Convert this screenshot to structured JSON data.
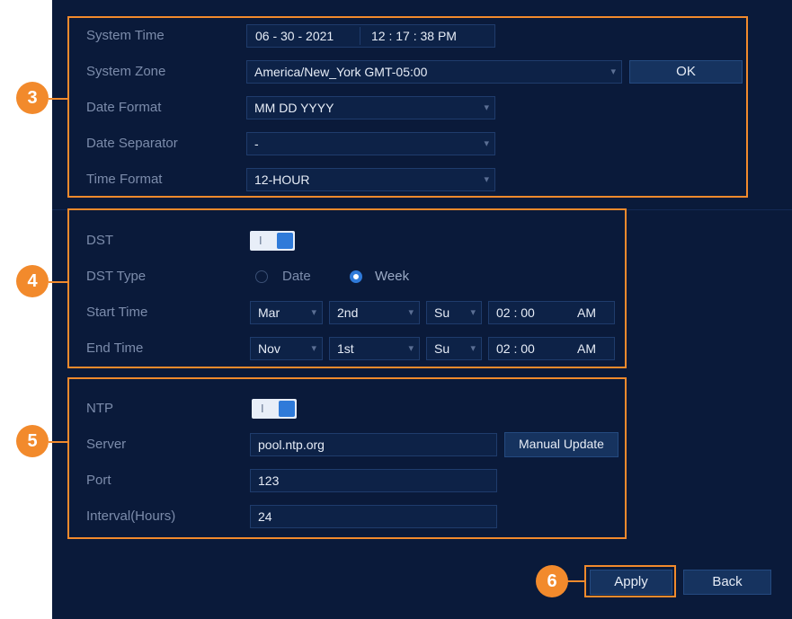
{
  "time_section": {
    "system_time_label": "System Time",
    "date_value": "06 - 30 - 2021",
    "time_value": "12 : 17 : 38  PM",
    "system_zone_label": "System Zone",
    "zone_value": "America/New_York GMT-05:00",
    "ok_label": "OK",
    "date_format_label": "Date Format",
    "date_format_value": "MM DD YYYY",
    "date_separator_label": "Date Separator",
    "date_separator_value": "-",
    "time_format_label": "Time Format",
    "time_format_value": "12-HOUR"
  },
  "dst_section": {
    "dst_label": "DST",
    "dst_enabled": true,
    "dst_type_label": "DST Type",
    "date_option": "Date",
    "week_option": "Week",
    "selected_type": "Week",
    "start_time_label": "Start Time",
    "start_month": "Mar",
    "start_week": "2nd",
    "start_day": "Su",
    "start_time": "02 : 00",
    "start_ampm": "AM",
    "end_time_label": "End Time",
    "end_month": "Nov",
    "end_week": "1st",
    "end_day": "Su",
    "end_time": "02 : 00",
    "end_ampm": "AM"
  },
  "ntp_section": {
    "ntp_label": "NTP",
    "ntp_enabled": true,
    "server_label": "Server",
    "server_value": "pool.ntp.org",
    "manual_update_label": "Manual Update",
    "port_label": "Port",
    "port_value": "123",
    "interval_label": "Interval(Hours)",
    "interval_value": "24"
  },
  "footer": {
    "apply_label": "Apply",
    "back_label": "Back"
  },
  "toggle_mark": "I",
  "callouts": [
    "3",
    "4",
    "5",
    "6"
  ],
  "colors": {
    "panel_bg": "#0a1a3a",
    "callout": "#f28a2c",
    "accent": "#2f7ad9"
  }
}
